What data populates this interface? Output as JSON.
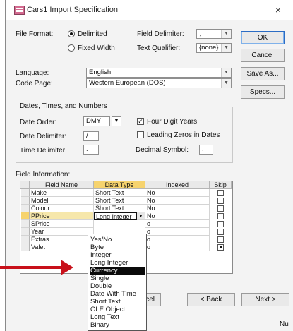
{
  "window": {
    "title": "Cars1 Import Specification",
    "close": "×"
  },
  "file_format": {
    "label": "File Format:",
    "delimited": "Delimited",
    "fixed_width": "Fixed Width",
    "selected": "Delimited"
  },
  "field_delimiter": {
    "label": "Field Delimiter:",
    "value": ";"
  },
  "text_qualifier": {
    "label": "Text Qualifier:",
    "value": "{none}"
  },
  "language": {
    "label": "Language:",
    "value": "English"
  },
  "code_page": {
    "label": "Code Page:",
    "value": "Western European (DOS)"
  },
  "buttons": {
    "ok": "OK",
    "cancel": "Cancel",
    "save_as": "Save As...",
    "specs": "Specs..."
  },
  "dates": {
    "group_label": "Dates, Times, and Numbers",
    "date_order_label": "Date Order:",
    "date_order": "DMY",
    "date_delimiter_label": "Date Delimiter:",
    "date_delimiter": "/",
    "time_delimiter_label": "Time Delimiter:",
    "time_delimiter": ":",
    "four_digit_years": "Four Digit Years",
    "four_digit_years_checked": true,
    "leading_zeros": "Leading Zeros in Dates",
    "leading_zeros_checked": false,
    "decimal_symbol_label": "Decimal Symbol:",
    "decimal_symbol": ","
  },
  "field_info": {
    "label": "Field Information:",
    "columns": [
      "Field Name",
      "Data Type",
      "Indexed",
      "Skip"
    ],
    "rows": [
      {
        "name": "Make",
        "type": "Short Text",
        "indexed": "No",
        "skip": false
      },
      {
        "name": "Model",
        "type": "Short Text",
        "indexed": "No",
        "skip": false
      },
      {
        "name": "Colour",
        "type": "Short Text",
        "indexed": "No",
        "skip": false
      },
      {
        "name": "PPrice",
        "type": "Long Integer",
        "indexed": "No",
        "skip": false
      },
      {
        "name": "SPrice",
        "type": "",
        "indexed": "o",
        "skip": false
      },
      {
        "name": "Year",
        "type": "",
        "indexed": "o",
        "skip": false
      },
      {
        "name": "Extras",
        "type": "",
        "indexed": "o",
        "skip": false
      },
      {
        "name": "Valet",
        "type": "",
        "indexed": "o",
        "skip": true
      }
    ]
  },
  "data_type_dropdown": {
    "options": [
      "Yes/No",
      "Byte",
      "Integer",
      "Long Integer",
      "Currency",
      "Single",
      "Double",
      "Date With Time",
      "Short Text",
      "OLE Object",
      "Long Text",
      "Binary"
    ],
    "highlighted": "Currency"
  },
  "footer": {
    "cancel_partial": "ncel",
    "back": "< Back",
    "next": "Next >",
    "status": "Nu"
  },
  "colors": {
    "highlight_header": "#f6d36e",
    "arrow": "#c8101a",
    "selection": "#0a0a0a"
  }
}
